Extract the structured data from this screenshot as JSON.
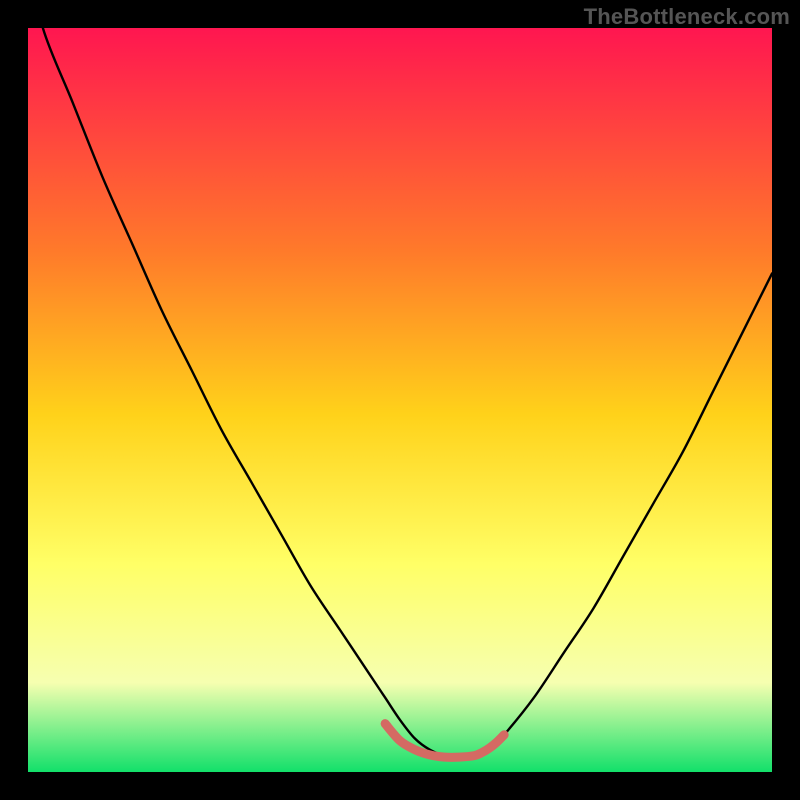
{
  "watermark": "TheBottleneck.com",
  "colors": {
    "frame": "#000000",
    "gradient_top": "#ff1650",
    "gradient_mid_upper": "#ff7a2a",
    "gradient_mid": "#ffd21a",
    "gradient_mid_lower": "#ffff66",
    "gradient_lower": "#f6ffb0",
    "gradient_bottom": "#12e06a",
    "curve": "#000000",
    "highlight": "#d46a63"
  },
  "chart_data": {
    "type": "line",
    "title": "",
    "xlabel": "",
    "ylabel": "",
    "xlim": [
      0,
      100
    ],
    "ylim": [
      0,
      100
    ],
    "series": [
      {
        "name": "curve",
        "x": [
          0,
          2,
          6,
          10,
          14,
          18,
          22,
          26,
          30,
          34,
          38,
          42,
          46,
          48,
          50,
          52,
          54,
          56,
          58,
          60,
          62,
          64,
          68,
          72,
          76,
          80,
          84,
          88,
          92,
          96,
          100
        ],
        "y": [
          110,
          100,
          90,
          80,
          71,
          62,
          54,
          46,
          39,
          32,
          25,
          19,
          13,
          10,
          7,
          4.5,
          3,
          2.2,
          2,
          2.2,
          3,
          5,
          10,
          16,
          22,
          29,
          36,
          43,
          51,
          59,
          67
        ]
      },
      {
        "name": "highlight",
        "x": [
          48,
          50,
          52,
          54,
          56,
          58,
          60,
          61,
          62,
          63,
          64
        ],
        "y": [
          6.5,
          4.2,
          3,
          2.3,
          2,
          2,
          2.2,
          2.6,
          3.2,
          4,
          5
        ]
      }
    ],
    "annotations": []
  }
}
